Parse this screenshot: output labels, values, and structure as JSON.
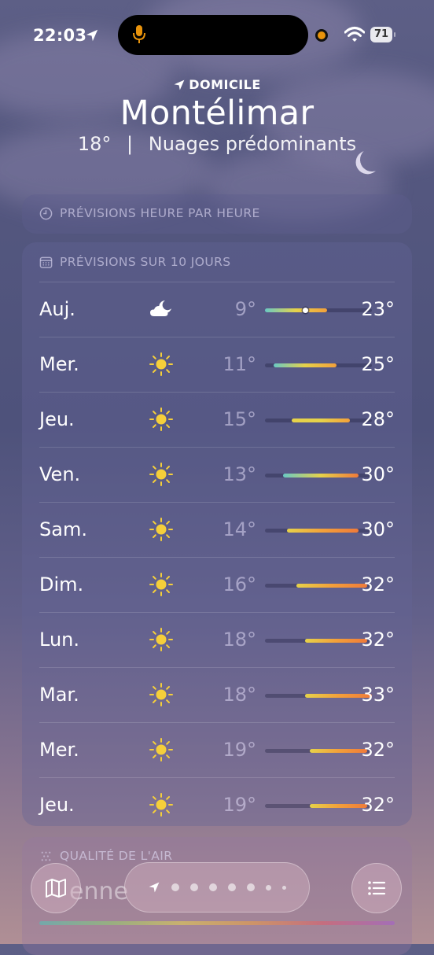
{
  "status_bar": {
    "time": "22:03",
    "battery": "71",
    "icons": [
      "location-arrow-icon",
      "microphone-icon",
      "orange-indicator-dot",
      "wifi-icon",
      "battery-icon"
    ]
  },
  "header": {
    "home_label": "DOMICILE",
    "city": "Montélimar",
    "temperature": "18°",
    "separator": "|",
    "condition": "Nuages prédominants"
  },
  "hourly": {
    "title": "PRÉVISIONS HEURE PAR HEURE"
  },
  "daily": {
    "title": "PRÉVISIONS SUR 10 JOURS",
    "range_min": 9,
    "range_max": 33,
    "current_temp": 18,
    "days": [
      {
        "day": "Auj.",
        "icon": "partly-cloudy-night-icon",
        "low": "9°",
        "high": "23°",
        "lo": 9,
        "hi": 23,
        "current": true
      },
      {
        "day": "Mer.",
        "icon": "sun-icon",
        "low": "11°",
        "high": "25°",
        "lo": 11,
        "hi": 25
      },
      {
        "day": "Jeu.",
        "icon": "sun-icon",
        "low": "15°",
        "high": "28°",
        "lo": 15,
        "hi": 28
      },
      {
        "day": "Ven.",
        "icon": "sun-icon",
        "low": "13°",
        "high": "30°",
        "lo": 13,
        "hi": 30
      },
      {
        "day": "Sam.",
        "icon": "sun-icon",
        "low": "14°",
        "high": "30°",
        "lo": 14,
        "hi": 30
      },
      {
        "day": "Dim.",
        "icon": "sun-icon",
        "low": "16°",
        "high": "32°",
        "lo": 16,
        "hi": 32
      },
      {
        "day": "Lun.",
        "icon": "sun-icon",
        "low": "18°",
        "high": "32°",
        "lo": 18,
        "hi": 32
      },
      {
        "day": "Mar.",
        "icon": "sun-icon",
        "low": "18°",
        "high": "33°",
        "lo": 18,
        "hi": 33
      },
      {
        "day": "Mer.",
        "icon": "sun-icon",
        "low": "19°",
        "high": "32°",
        "lo": 19,
        "hi": 32
      },
      {
        "day": "Jeu.",
        "icon": "sun-icon",
        "low": "19°",
        "high": "32°",
        "lo": 19,
        "hi": 32
      }
    ]
  },
  "air_quality": {
    "title": "QUALITÉ DE L'AIR",
    "value": "enne"
  },
  "bottom_bar": {
    "map_button": "map-icon",
    "list_button": "list-icon",
    "page_count": 7
  },
  "colors": {
    "cool": "#69c9c4",
    "mild": "#e6d24a",
    "warm": "#f3a03a",
    "hot": "#ef7a3a"
  }
}
